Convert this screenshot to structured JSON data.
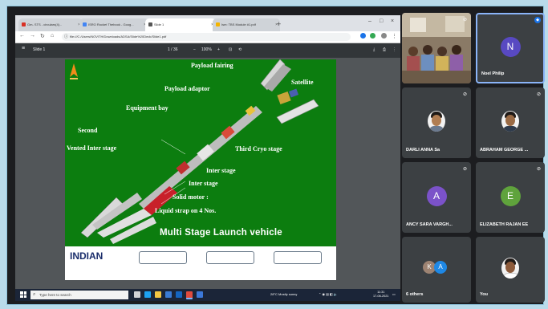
{
  "browser": {
    "tabs": [
      {
        "title": "Gm- STS - circulars(4)..."
      },
      {
        "title": "ISRO Rocket Thebook - Goog..."
      },
      {
        "title": "Slide 1"
      },
      {
        "title": "Ism: TBS Module #1.pdf"
      }
    ],
    "url": "file:///C:/Users/NOVITH/Downloads/ADSA/Slide%20Deck/Slide1.pdf"
  },
  "pdf_toolbar": {
    "filename": "Slide 1",
    "page_indicator": "1 / 36",
    "zoom": "100%"
  },
  "slide": {
    "labels": {
      "payload_fairing": "Payload fairing",
      "satellite": "Satellite",
      "payload_adaptor": "Payload adaptor",
      "equipment_bay": "Equipment bay",
      "second": "Second",
      "vented_inter_stage": "Vented Inter stage",
      "third_cryo_stage": "Third Cryo stage",
      "inter_stage_1": "Inter stage",
      "inter_stage_2": "Inter stage",
      "solid_motor": "Solid motor :",
      "liquid_strap": "Liquid strap on 4 Nos."
    },
    "title": "Multi Stage Launch vehicle",
    "footer_text": "INDIAN"
  },
  "taskbar": {
    "search_placeholder": "Type here to search",
    "weather": "28°C  Mostly sunny",
    "time": "11:31",
    "date": "17-06-2021"
  },
  "participants": [
    {
      "name": "",
      "type": "video"
    },
    {
      "name": "Noel Philip",
      "initial": "N",
      "color": "#5849c2",
      "active": true
    },
    {
      "name": "DARLI ANNA Sa",
      "type": "photo"
    },
    {
      "name": "ABRAHAM GEORGE ...",
      "type": "photo"
    },
    {
      "name": "ANCY SARA VARGH...",
      "initial": "A",
      "color": "#7b52c9"
    },
    {
      "name": "ELIZABETH RAJAN EE",
      "initial": "E",
      "color": "#5fa33c"
    },
    {
      "name": "6 others",
      "type": "group"
    },
    {
      "name": "You",
      "type": "photo"
    }
  ],
  "colors": {
    "slide_green": "#0c7d0f",
    "accent_blue": "#8ab4f8",
    "tile_bg": "#3c4043"
  }
}
